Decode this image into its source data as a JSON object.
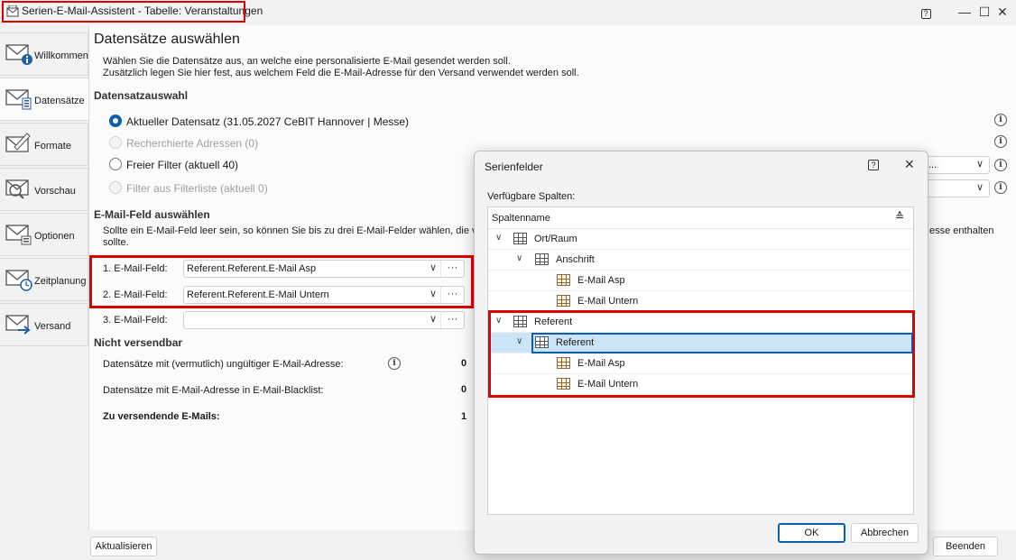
{
  "window": {
    "title": "Serien-E-Mail-Assistent - Tabelle: Veranstaltungen",
    "help_glyph": "?",
    "minimize_glyph": "—",
    "maximize_glyph": "☐",
    "close_glyph": "✕"
  },
  "sidebar": {
    "items": [
      {
        "label": "Willkommen",
        "icon": "mail-info-icon"
      },
      {
        "label": "Datensätze",
        "icon": "mail-list-icon",
        "active": true
      },
      {
        "label": "Formate",
        "icon": "mail-pen-icon"
      },
      {
        "label": "Vorschau",
        "icon": "mail-search-icon"
      },
      {
        "label": "Optionen",
        "icon": "mail-settings-icon"
      },
      {
        "label": "Zeitplanung",
        "icon": "mail-clock-icon"
      },
      {
        "label": "Versand",
        "icon": "mail-send-icon"
      }
    ]
  },
  "main": {
    "heading": "Datensätze auswählen",
    "intro_line1": "Wählen Sie die Datensätze aus, an welche eine personalisierte E-Mail gesendet werden soll.",
    "intro_line2": "Zusätzlich legen Sie hier fest, aus welchem Feld die E-Mail-Adresse für den Versand verwendet werden soll.",
    "selection": {
      "title": "Datensatzauswahl",
      "options": [
        {
          "label": "Aktueller Datensatz (31.05.2027 CeBIT Hannover | Messe)",
          "checked": true,
          "disabled": false
        },
        {
          "label": "Recherchierte Adressen (0)",
          "checked": false,
          "disabled": true
        },
        {
          "label": "Freier Filter (aktuell 40)",
          "checked": false,
          "disabled": false
        },
        {
          "label": "Filter aus Filterliste (aktuell 0)",
          "checked": false,
          "disabled": true
        }
      ],
      "filter_combo_value": "...",
      "info_glyph": "i"
    },
    "email_field": {
      "title": "E-Mail-Feld auswählen",
      "description_line1": "Sollte ein E-Mail-Feld leer sein, so können Sie bis zu drei E-Mail-Felder wählen, die verw",
      "description_tail": "esse enthalten",
      "description_line2": "sollte.",
      "fields": [
        {
          "label": "1. E-Mail-Feld:",
          "value": "Referent.Referent.E-Mail Asp"
        },
        {
          "label": "2. E-Mail-Feld:",
          "value": "Referent.Referent.E-Mail Untern"
        },
        {
          "label": "3. E-Mail-Feld:",
          "value": ""
        }
      ],
      "chevron_glyph": "∨",
      "dots_glyph": "···"
    },
    "not_sendable": {
      "title": "Nicht versendbar",
      "rows": [
        {
          "label": "Datensätze mit (vermutlich) ungültiger E-Mail-Adresse:",
          "value": "0"
        },
        {
          "label": "Datensätze mit E-Mail-Adresse in E-Mail-Blacklist:",
          "value": "0"
        },
        {
          "label": "Zu versendende E-Mails:",
          "value": "1"
        }
      ]
    }
  },
  "footer": {
    "refresh_button": "Aktualisieren",
    "finish_button": "Beenden"
  },
  "dialog": {
    "title": "Serienfelder",
    "help_glyph": "?",
    "close_glyph": "✕",
    "available_label": "Verfügbare Spalten:",
    "column_header": "Spaltenname",
    "sort_glyph": "≙",
    "tree": [
      {
        "label": "Ort/Raum",
        "level": 0,
        "expanded": true
      },
      {
        "label": "Anschrift",
        "level": 1,
        "expanded": true
      },
      {
        "label": "E-Mail Asp",
        "level": 2
      },
      {
        "label": "E-Mail Untern",
        "level": 2
      },
      {
        "label": "Referent",
        "level": 0,
        "expanded": true
      },
      {
        "label": "Referent",
        "level": 1,
        "expanded": true,
        "selected": true
      },
      {
        "label": "E-Mail Asp",
        "level": 2
      },
      {
        "label": "E-Mail Untern",
        "level": 2
      }
    ],
    "ok_button": "OK",
    "cancel_button": "Abbrechen"
  }
}
